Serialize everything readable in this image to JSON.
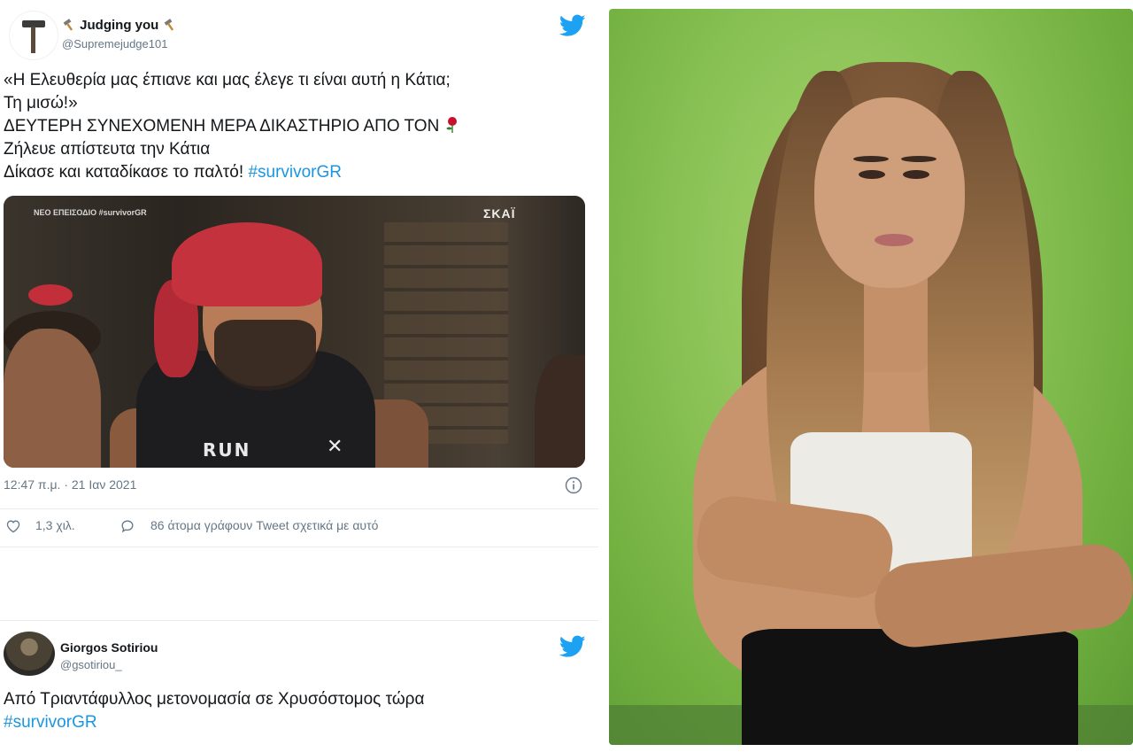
{
  "tweet1": {
    "name_prefix_icon": "hammer-icon",
    "name": "Judging you",
    "handle": "@Supremejudge101",
    "text_lines": [
      "«Η Ελευθερία μας έπιανε και μας έλεγε τι είναι αυτή η Κάτια;",
      "Τη μισώ!»",
      "ΔΕΥΤΕΡΗ ΣΥΝΕΧΟΜΕΝΗ ΜΕΡΑ ΔΙΚΑΣΤΗΡΙΟ ΑΠΟ ΤΟΝ",
      "Ζήλευε απίστευτα την Κάτια",
      "Δίκασε και καταδίκασε το παλτό!"
    ],
    "hashtag": "#survivorGR",
    "media": {
      "channel": "ΣΚΑΪ",
      "shirt_text": "RUN",
      "watermark": "ΝΕΟ ΕΠΕΙΣΟΔΙΟ #survivorGR"
    },
    "timestamp": "12:47 π.μ. · 21 Ιαν 2021",
    "likes": "1,3 χιλ.",
    "comments": "86 άτομα γράφουν Tweet σχετικά με αυτό"
  },
  "tweet2": {
    "name": "Giorgos Sotiriou",
    "handle": "@gsotiriou_",
    "text": "Από Τριαντάφυλλος μετονομασία σε Χρυσόστομος τώρα",
    "hashtag": "#survivorGR"
  },
  "colors": {
    "twitter_blue": "#1da1f2",
    "hashtag": "#1b95e0",
    "muted": "#657786",
    "green_screen": "#8ac256"
  }
}
